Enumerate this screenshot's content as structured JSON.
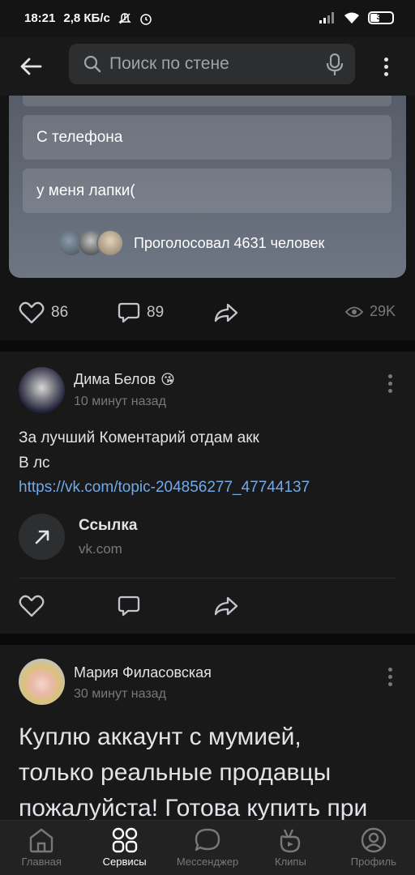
{
  "status_bar": {
    "time": "18:21",
    "network_speed": "2,8 КБ/с",
    "battery": "39"
  },
  "header": {
    "search_placeholder": "Поиск по стене"
  },
  "poll": {
    "options": [
      "С телефона",
      "у меня лапки("
    ],
    "voted_text": "Проголосовал 4631 человек"
  },
  "post_actions_1": {
    "likes": "86",
    "comments": "89",
    "views": "29K"
  },
  "post_2": {
    "author": "Дима Белов",
    "author_emoji": "😘",
    "time": "10 минут назад",
    "text_line1": "За лучший Коментарий отдам акк",
    "text_line2": "В лс",
    "link": "https://vk.com/topic-204856277_47744137",
    "link_card_title": "Ссылка",
    "link_card_domain": "vk.com"
  },
  "post_3": {
    "author": "Мария Филасовская",
    "time": "30 минут назад",
    "text_line1": "Куплю аккаунт с мумией,",
    "text_line2": "только реальные продавцы",
    "text_line3": "пожалуйста! Готова купить при"
  },
  "bottom_nav": {
    "items": [
      "Главная",
      "Сервисы",
      "Мессенджер",
      "Клипы",
      "Профиль"
    ],
    "active": "Сервисы"
  },
  "colors": {
    "background": "#141414",
    "card": "#19191a",
    "link": "#71aaeb",
    "muted": "#76787a"
  }
}
